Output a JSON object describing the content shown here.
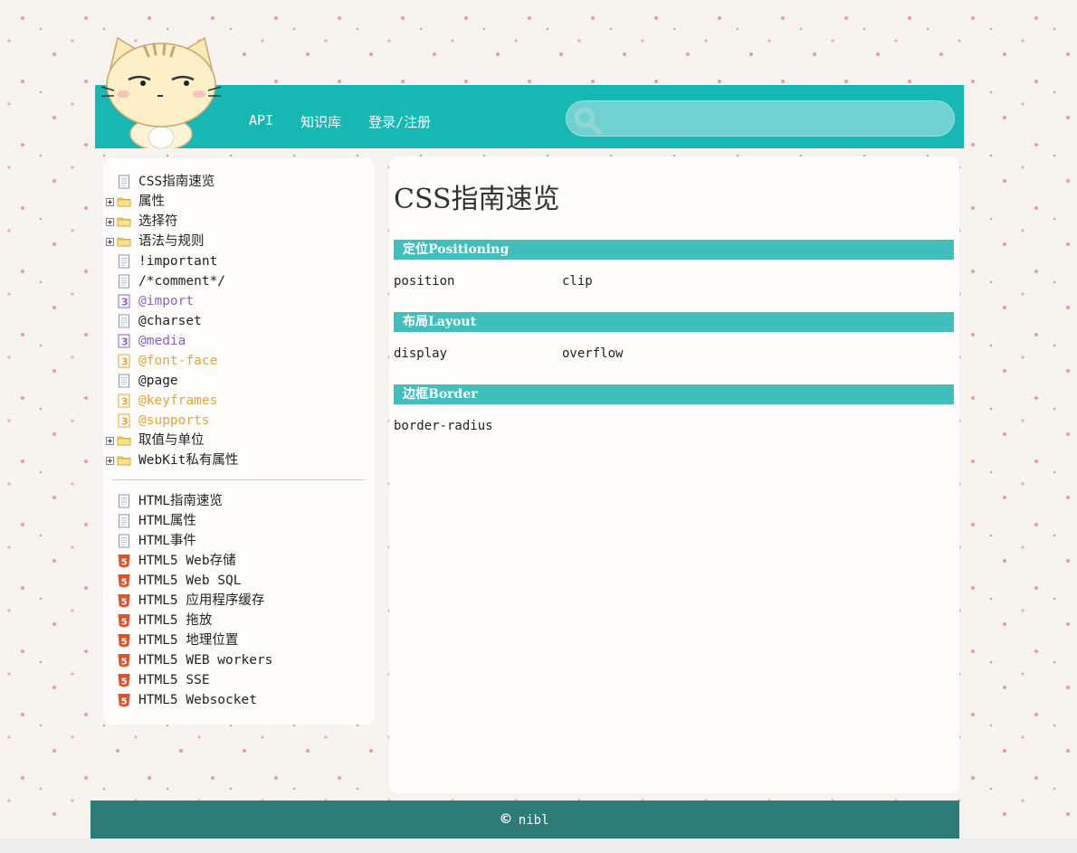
{
  "header": {
    "nav": [
      "API",
      "知识库",
      "登录/注册"
    ],
    "search": {
      "placeholder": "",
      "value": ""
    }
  },
  "sidebar": {
    "css_items": [
      {
        "label": "CSS指南速览",
        "icon": "doc-icon",
        "expandable": false,
        "color": "default"
      },
      {
        "label": "属性",
        "icon": "folder-icon",
        "expandable": true,
        "color": "default"
      },
      {
        "label": "选择符",
        "icon": "folder-icon",
        "expandable": true,
        "color": "default"
      },
      {
        "label": "语法与规则",
        "icon": "folder-icon",
        "expandable": true,
        "color": "default"
      },
      {
        "label": "!important",
        "icon": "doc-icon",
        "expandable": false,
        "color": "default"
      },
      {
        "label": "/*comment*/",
        "icon": "doc-icon",
        "expandable": false,
        "color": "default"
      },
      {
        "label": "@import",
        "icon": "css3-purple-icon",
        "expandable": false,
        "color": "purple"
      },
      {
        "label": "@charset",
        "icon": "doc-icon",
        "expandable": false,
        "color": "default"
      },
      {
        "label": "@media",
        "icon": "css3-purple-icon",
        "expandable": false,
        "color": "purple"
      },
      {
        "label": "@font-face",
        "icon": "css3-orange-icon",
        "expandable": false,
        "color": "orange"
      },
      {
        "label": "@page",
        "icon": "doc-icon",
        "expandable": false,
        "color": "default"
      },
      {
        "label": "@keyframes",
        "icon": "css3-orange-icon",
        "expandable": false,
        "color": "orange"
      },
      {
        "label": "@supports",
        "icon": "css3-orange-icon",
        "expandable": false,
        "color": "orange"
      },
      {
        "label": "取值与单位",
        "icon": "folder-icon",
        "expandable": true,
        "color": "default"
      },
      {
        "label": "WebKit私有属性",
        "icon": "folder-icon",
        "expandable": true,
        "color": "default"
      }
    ],
    "html_items": [
      {
        "label": "HTML指南速览",
        "icon": "doc-icon"
      },
      {
        "label": "HTML属性",
        "icon": "doc-icon"
      },
      {
        "label": "HTML事件",
        "icon": "doc-icon"
      },
      {
        "label": "HTML5 Web存储",
        "icon": "html5-icon"
      },
      {
        "label": "HTML5 Web SQL",
        "icon": "html5-icon"
      },
      {
        "label": "HTML5 应用程序缓存",
        "icon": "html5-icon"
      },
      {
        "label": "HTML5 拖放",
        "icon": "html5-icon"
      },
      {
        "label": "HTML5 地理位置",
        "icon": "html5-icon"
      },
      {
        "label": "HTML5 WEB workers",
        "icon": "html5-icon"
      },
      {
        "label": "HTML5 SSE",
        "icon": "html5-icon"
      },
      {
        "label": "HTML5 Websocket",
        "icon": "html5-icon"
      }
    ]
  },
  "main": {
    "title": "CSS指南速览",
    "sections": [
      {
        "heading": "定位Positioning",
        "links": [
          "position",
          "clip"
        ]
      },
      {
        "heading": "布局Layout",
        "links": [
          "display",
          "overflow"
        ]
      },
      {
        "heading": "边框Border",
        "links": [
          "border-radius"
        ]
      }
    ]
  },
  "footer": {
    "copyright_symbol": "©",
    "text": "nibl"
  },
  "colors": {
    "header_teal": "#17b7b3",
    "section_teal": "#41bfbc",
    "footer_teal": "#2d7c78",
    "css3_purple": "#8a63c9",
    "css3_orange": "#e6a53a",
    "html5_red": "#e34f26"
  }
}
